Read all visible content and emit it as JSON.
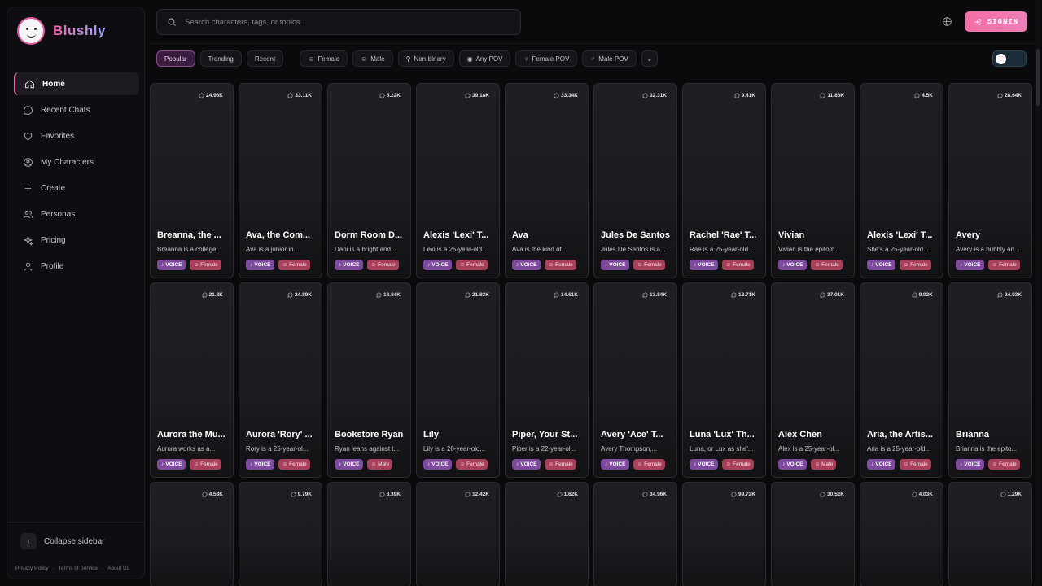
{
  "app": {
    "name": "Blushly"
  },
  "search": {
    "placeholder": "Search characters, tags, or topics..."
  },
  "header": {
    "signin_label": "SIGNIN"
  },
  "sidebar": {
    "items": [
      {
        "label": "Home",
        "icon": "home-icon"
      },
      {
        "label": "Recent Chats",
        "icon": "chat-icon"
      },
      {
        "label": "Favorites",
        "icon": "heart-icon"
      },
      {
        "label": "My Characters",
        "icon": "user-circle-icon"
      },
      {
        "label": "Create",
        "icon": "plus-icon"
      },
      {
        "label": "Personas",
        "icon": "users-icon"
      },
      {
        "label": "Pricing",
        "icon": "sparkle-icon"
      },
      {
        "label": "Profile",
        "icon": "user-icon"
      }
    ],
    "collapse_label": "Collapse sidebar",
    "footer": [
      "Privacy Policy",
      "Terms of Service",
      "About Us"
    ]
  },
  "filters": {
    "sort": [
      "Popular",
      "Trending",
      "Recent"
    ],
    "gender": [
      "Female",
      "Male",
      "Non-binary"
    ],
    "pov": [
      "Any POV",
      "Female POV",
      "Male POV"
    ]
  },
  "tag_labels": {
    "voice": "VOICE"
  },
  "cards": [
    {
      "name": "Breanna, the ...",
      "desc": "Breanna is a college...",
      "count": "24.96K",
      "gender": "Female"
    },
    {
      "name": "Ava, the Com...",
      "desc": "Ava is a junior in...",
      "count": "33.11K",
      "gender": "Female"
    },
    {
      "name": "Dorm Room D...",
      "desc": "Dani is a bright and...",
      "count": "5.22K",
      "gender": "Female"
    },
    {
      "name": "Alexis 'Lexi' T...",
      "desc": "Lexi is a 25-year-old...",
      "count": "39.18K",
      "gender": "Female"
    },
    {
      "name": "Ava",
      "desc": "Ava is the kind of...",
      "count": "33.34K",
      "gender": "Female"
    },
    {
      "name": "Jules De Santos",
      "desc": "Jules De Santos is a...",
      "count": "32.31K",
      "gender": "Female"
    },
    {
      "name": "Rachel 'Rae' T...",
      "desc": "Rae is a 25-year-old...",
      "count": "9.41K",
      "gender": "Female"
    },
    {
      "name": "Vivian",
      "desc": "Vivian is the epitom...",
      "count": "11.86K",
      "gender": "Female"
    },
    {
      "name": "Alexis 'Lexi' T...",
      "desc": "She's a 25-year-old...",
      "count": "4.5K",
      "gender": "Female"
    },
    {
      "name": "Avery",
      "desc": "Avery is a bubbly an...",
      "count": "28.64K",
      "gender": "Female"
    },
    {
      "name": "Aurora the Mu...",
      "desc": "Aurora works as a...",
      "count": "21.8K",
      "gender": "Female"
    },
    {
      "name": "Aurora 'Rory' ...",
      "desc": "Rory is a 25-year-ol...",
      "count": "24.89K",
      "gender": "Female"
    },
    {
      "name": "Bookstore Ryan",
      "desc": "Ryan leans against t...",
      "count": "18.84K",
      "gender": "Male"
    },
    {
      "name": "Lily",
      "desc": "Lily is a 20-year-old...",
      "count": "21.83K",
      "gender": "Female"
    },
    {
      "name": "Piper, Your St...",
      "desc": "Piper is a 22-year-ol...",
      "count": "14.61K",
      "gender": "Female"
    },
    {
      "name": "Avery 'Ace' T...",
      "desc": "Avery Thompson,...",
      "count": "13.84K",
      "gender": "Female"
    },
    {
      "name": "Luna 'Lux' Th...",
      "desc": "Luna, or Lux as she'...",
      "count": "12.71K",
      "gender": "Female"
    },
    {
      "name": "Alex Chen",
      "desc": "Alex is a 25-year-ol...",
      "count": "37.01K",
      "gender": "Male"
    },
    {
      "name": "Aria, the Artis...",
      "desc": "Aria is a 25-year-old...",
      "count": "9.92K",
      "gender": "Female"
    },
    {
      "name": "Brianna",
      "desc": "Brianna is the epito...",
      "count": "24.93K",
      "gender": "Female"
    },
    {
      "count": "4.53K"
    },
    {
      "count": "9.79K"
    },
    {
      "count": "8.39K"
    },
    {
      "count": "12.42K"
    },
    {
      "count": "1.62K"
    },
    {
      "count": "34.96K"
    },
    {
      "count": "99.72K"
    },
    {
      "count": "30.52K"
    },
    {
      "count": "4.03K"
    },
    {
      "count": "1.29K"
    }
  ]
}
